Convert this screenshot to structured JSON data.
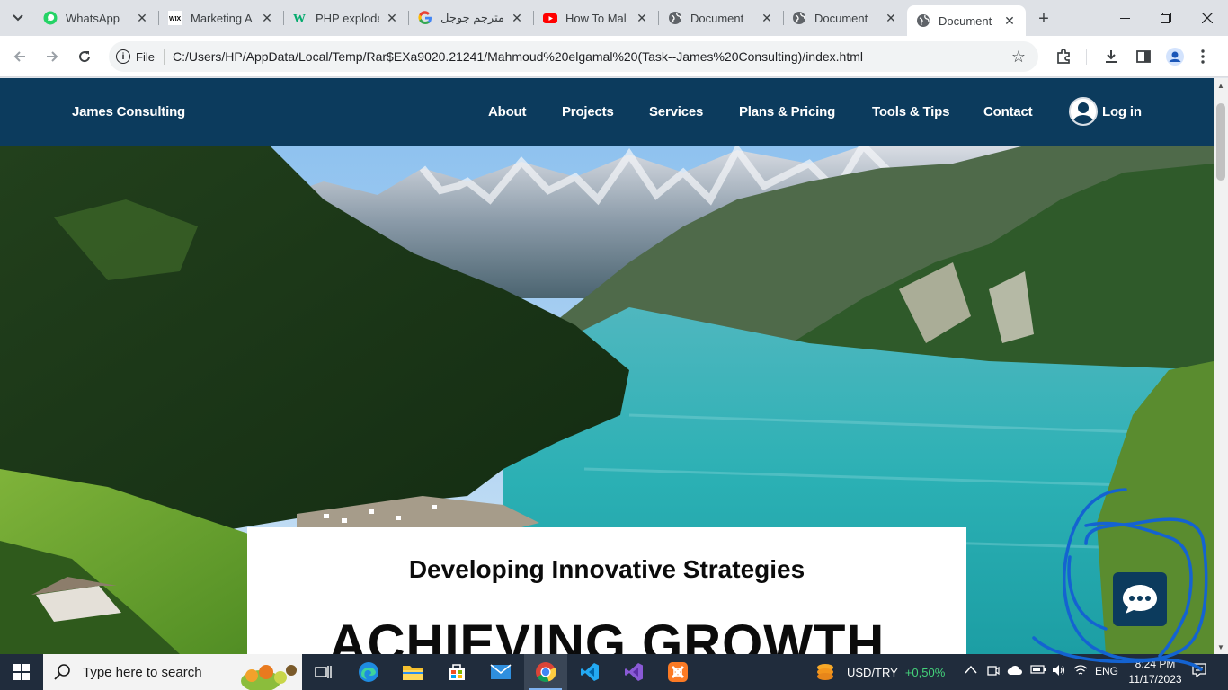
{
  "browser": {
    "tabs": [
      {
        "title": "WhatsApp",
        "icon": "whatsapp-icon",
        "active": false
      },
      {
        "title": "Marketing A",
        "icon": "wix-icon",
        "active": false
      },
      {
        "title": "PHP explode",
        "icon": "w3schools-icon",
        "active": false
      },
      {
        "title": "مترجم جوجل",
        "icon": "google-icon",
        "active": false
      },
      {
        "title": "How To Mal",
        "icon": "youtube-icon",
        "active": false
      },
      {
        "title": "Document",
        "icon": "globe-icon",
        "active": false
      },
      {
        "title": "Document",
        "icon": "globe-icon",
        "active": false
      },
      {
        "title": "Document",
        "icon": "globe-icon",
        "active": true
      }
    ],
    "site_info_label": "File",
    "url": "C:/Users/HP/AppData/Local/Temp/Rar$EXa9020.21241/Mahmoud%20elgamal%20(Task--James%20Consulting)/index.html"
  },
  "site": {
    "brand": "James Consulting",
    "nav": [
      "About",
      "Projects",
      "Services",
      "Plans & Pricing",
      "Tools & Tips",
      "Contact"
    ],
    "login_label": "Log in",
    "headline_sub": "Developing Innovative Strategies",
    "headline_main": "ACHIEVING GROWTH",
    "colors": {
      "nav_bg": "#0c3b5d",
      "card_bg": "#ffffff"
    }
  },
  "taskbar": {
    "search_placeholder": "Type here to search",
    "ticker_name": "USD/TRY",
    "ticker_change": "+0,50%",
    "language": "ENG",
    "time": "8:24 PM",
    "date": "11/17/2023"
  }
}
